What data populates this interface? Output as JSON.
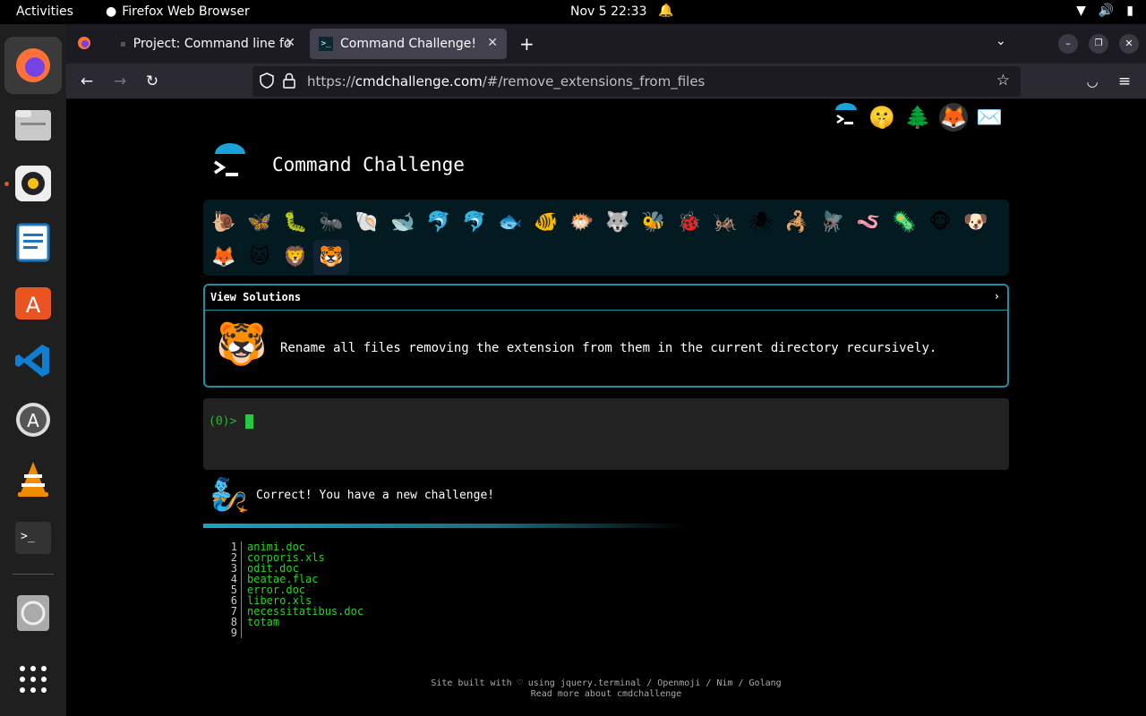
{
  "system": {
    "activities": "Activities",
    "app_name": "Firefox Web Browser",
    "clock": "Nov 5  22:33"
  },
  "tabs": [
    {
      "title": "Project: Command line fo",
      "active": false
    },
    {
      "title": "Command Challenge!",
      "active": true
    }
  ],
  "url": {
    "prefix": "https://",
    "domain": "cmdchallenge.com",
    "path": "/#/remove_extensions_from_files"
  },
  "site": {
    "title": "Command Challenge",
    "solutions_label": "View Solutions",
    "challenge_text": "Rename all files removing the extension from them in the current directory recursively.",
    "prompt": "(0)>",
    "correct_message": "Correct! You have a new challenge!"
  },
  "files": [
    {
      "n": "1",
      "name": "animi.doc"
    },
    {
      "n": "2",
      "name": "corporis.xls"
    },
    {
      "n": "3",
      "name": "odit.doc"
    },
    {
      "n": "4",
      "name": "beatae.flac"
    },
    {
      "n": "5",
      "name": "error.doc"
    },
    {
      "n": "6",
      "name": "libero.xls"
    },
    {
      "n": "7",
      "name": "necessitatibus.doc"
    },
    {
      "n": "8",
      "name": "totam"
    },
    {
      "n": "9",
      "name": ""
    }
  ],
  "footer": {
    "line1": "Site built with ♡ using jquery.terminal / Openmoji / Nim / Golang",
    "line2": "Read more about cmdchallenge"
  },
  "colors": {
    "accent": "#1f8fa5",
    "terminal_green": "#29d429"
  }
}
